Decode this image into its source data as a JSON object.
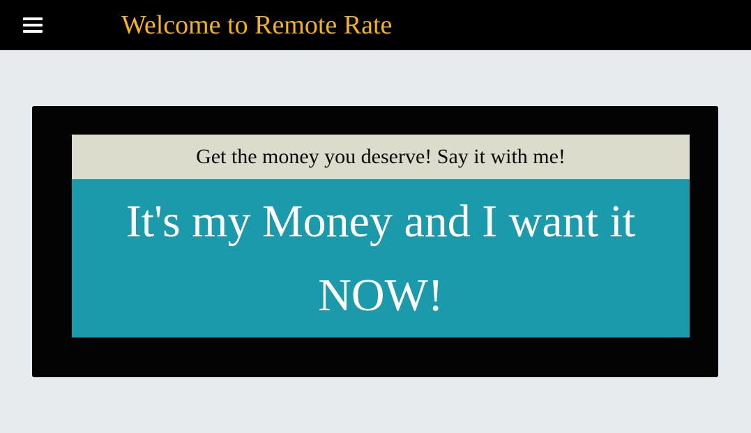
{
  "header": {
    "title": "Welcome to Remote Rate",
    "menu_icon": "hamburger-menu-icon",
    "background": "#000000",
    "title_color": "#f5b40e"
  },
  "hero": {
    "tagline": "Get the money you deserve! Say it with me!",
    "slogan": "It's my Money and I want it NOW!",
    "panel_color": "#030303",
    "tagline_bg": "#dcdccc",
    "slogan_bg": "#1b9aab"
  }
}
